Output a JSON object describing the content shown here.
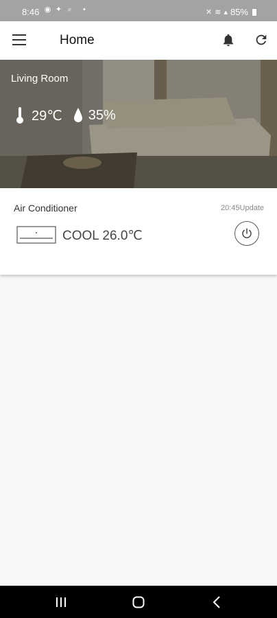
{
  "status_bar": {
    "time": "8:46",
    "left_icons": [
      "chat-icon",
      "twitter-icon",
      "search-icon"
    ],
    "dot": "•",
    "right_icons": [
      "mute-icon",
      "wifi-icon",
      "signal-icon"
    ],
    "battery": "85%"
  },
  "app_bar": {
    "title": "Home",
    "icons": [
      "menu-icon",
      "bell-icon",
      "refresh-icon"
    ]
  },
  "room": {
    "name": "Living Room",
    "temperature": "29℃",
    "humidity": "35%"
  },
  "device": {
    "name": "Air Conditioner",
    "update_text": "20:45Update",
    "mode_text": "COOL 26.0℃",
    "icons": [
      "air-conditioner-icon",
      "power-icon"
    ]
  },
  "nav_bar": {
    "icons": [
      "recents-icon",
      "home-icon",
      "back-icon"
    ]
  },
  "colors": {
    "status_bar": "#a3a3a3",
    "app_bar": "#ffffff",
    "background": "#f7f7f7",
    "nav_bar": "#000000"
  }
}
